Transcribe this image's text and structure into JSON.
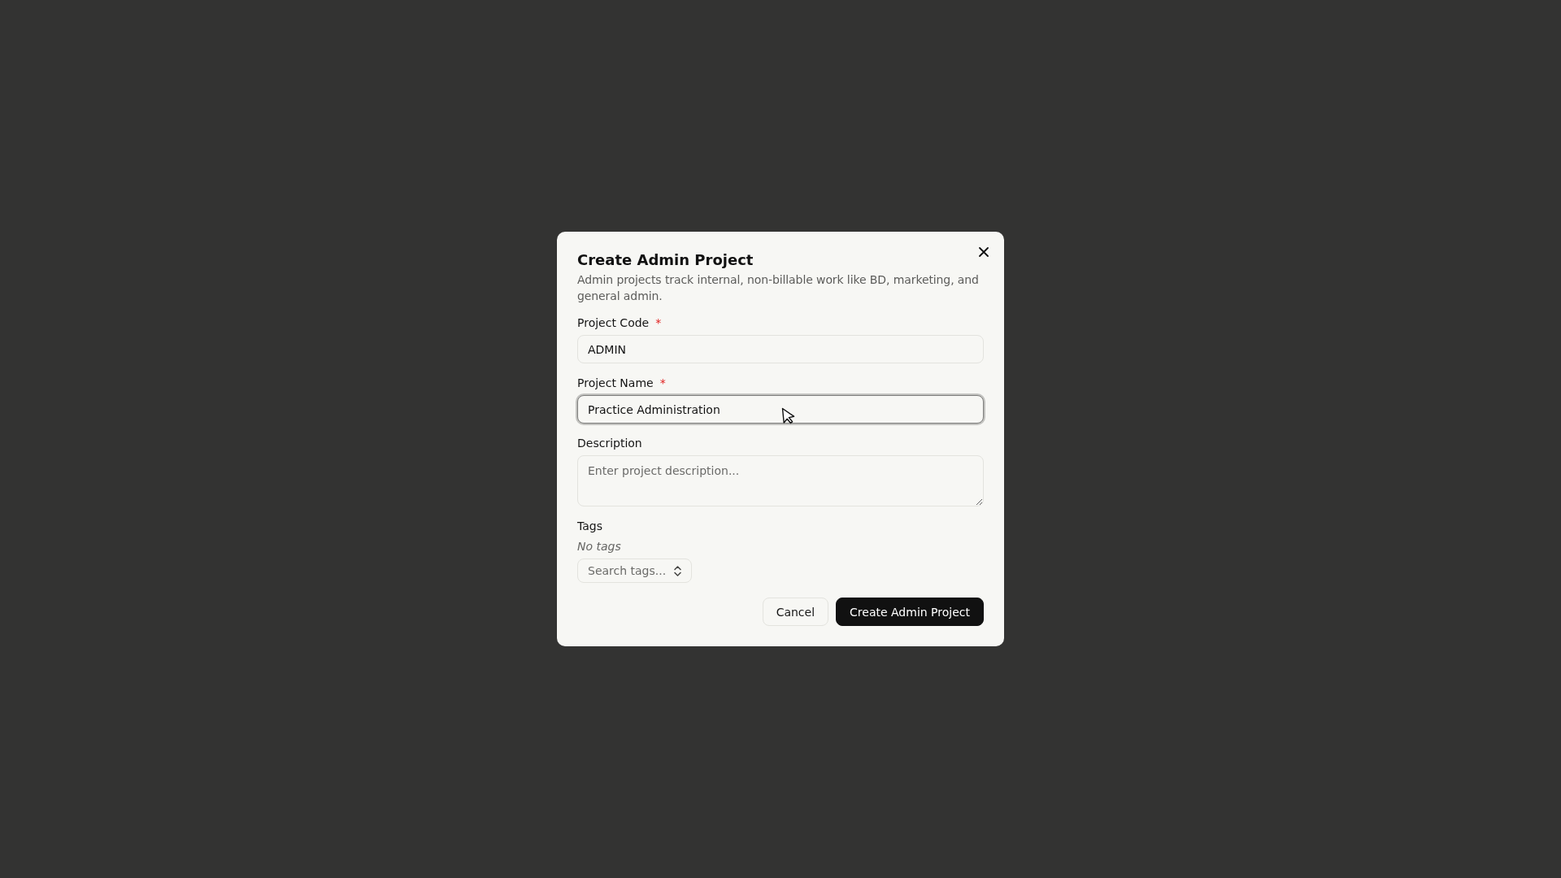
{
  "dialog": {
    "title": "Create Admin Project",
    "description": "Admin projects track internal, non-billable work like BD, marketing, and general admin.",
    "fields": [
      {
        "kind": "text",
        "label": "Project Code",
        "required_mark": "*",
        "value": "ADMIN",
        "focused": false
      },
      {
        "kind": "text",
        "label": "Project Name",
        "required_mark": "*",
        "value": "Practice Administration",
        "focused": true
      },
      {
        "kind": "textarea",
        "label": "Description",
        "placeholder": "Enter project description...",
        "focused": false
      },
      {
        "kind": "tags",
        "label": "Tags",
        "empty_text": "No tags",
        "placeholder": "Search tags...",
        "focused": false
      }
    ],
    "buttons": [
      {
        "kind": "secondary",
        "label": "Cancel"
      },
      {
        "kind": "primary",
        "label": "Create Admin Project"
      }
    ]
  }
}
